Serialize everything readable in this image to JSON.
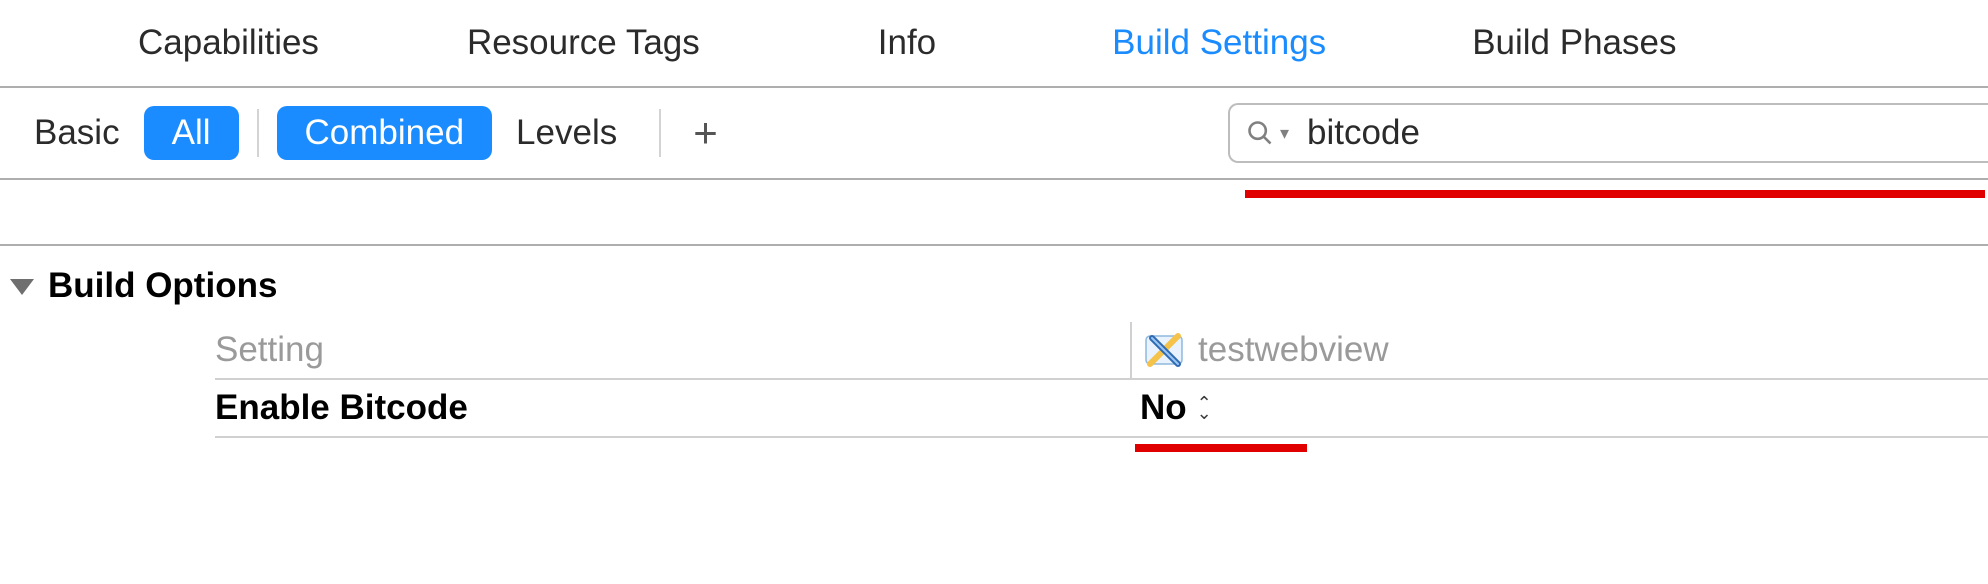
{
  "tabs": {
    "capabilities": "Capabilities",
    "resource_tags": "Resource Tags",
    "info": "Info",
    "build_settings": "Build Settings",
    "build_phases": "Build Phases",
    "active": "build_settings"
  },
  "toolbar": {
    "basic": "Basic",
    "all": "All",
    "combined": "Combined",
    "levels": "Levels"
  },
  "search": {
    "value": "bitcode"
  },
  "group": {
    "title": "Build Options",
    "column_label": "Setting",
    "target_name": "testwebview",
    "rows": [
      {
        "name": "Enable Bitcode",
        "value": "No"
      }
    ]
  }
}
